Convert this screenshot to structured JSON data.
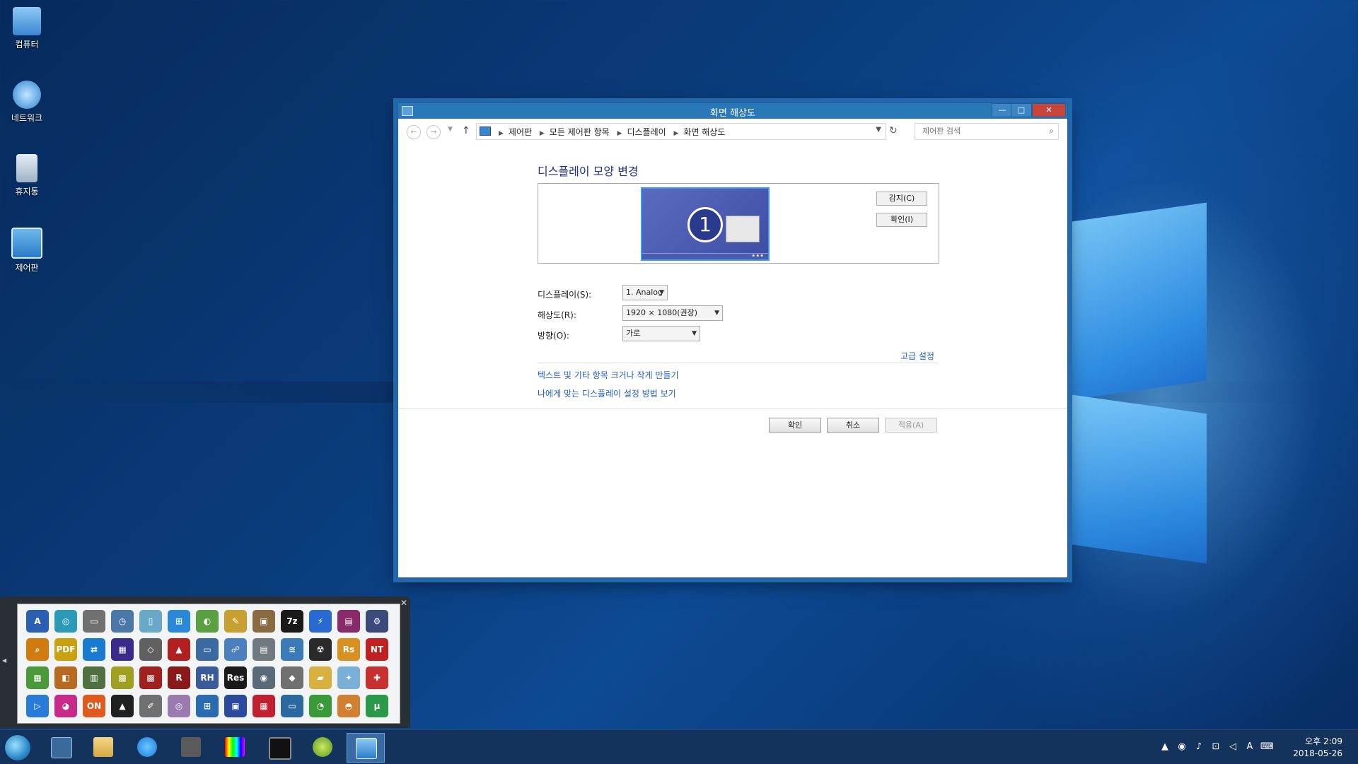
{
  "desktop": {
    "icons": [
      {
        "label": "컴퓨터"
      },
      {
        "label": "네트워크"
      },
      {
        "label": "휴지통"
      },
      {
        "label": "제어판"
      }
    ]
  },
  "window": {
    "title": "화면 해상도",
    "controls": {
      "minimize": "—",
      "maximize": "□",
      "close": "✕"
    },
    "address": {
      "crumbs": [
        "제어판",
        "모든 제어판 항목",
        "디스플레이",
        "화면 해상도"
      ]
    },
    "search": {
      "placeholder": "제어판 검색"
    },
    "heading": "디스플레이 모양 변경",
    "monitor_number": "1",
    "buttons": {
      "detect": "감지(C)",
      "identify": "확인(I)"
    },
    "fields": {
      "display": {
        "label": "디스플레이(S):",
        "value": "1. Analog"
      },
      "resolution": {
        "label": "해상도(R):",
        "value": "1920 × 1080(권장)"
      },
      "orientation": {
        "label": "방향(O):",
        "value": "가로"
      }
    },
    "links": {
      "advanced": "고급 설정",
      "text_size": "텍스트 및 기타 항목 크거나 작게 만들기",
      "which_settings": "나에게 맞는 디스플레이 설정 방법 보기"
    },
    "footer": {
      "ok": "확인",
      "cancel": "취소",
      "apply": "적용(A)"
    }
  },
  "launcher": {
    "close": "✕",
    "icons": [
      {
        "name": "text-editor-icon",
        "glyph": "A",
        "color": "#2b5fb4"
      },
      {
        "name": "sync-icon",
        "glyph": "◎",
        "color": "#2a9ab8"
      },
      {
        "name": "drive-icon",
        "glyph": "▭",
        "color": "#707070"
      },
      {
        "name": "backup-icon",
        "glyph": "◷",
        "color": "#4a78a8"
      },
      {
        "name": "usb-icon",
        "glyph": "▯",
        "color": "#6aa8c8"
      },
      {
        "name": "windows-icon",
        "glyph": "⊞",
        "color": "#2a88d8"
      },
      {
        "name": "paint-icon",
        "glyph": "◐",
        "color": "#5aa040"
      },
      {
        "name": "tools-icon",
        "glyph": "✎",
        "color": "#c8a030"
      },
      {
        "name": "image-icon",
        "glyph": "▣",
        "color": "#8a6a40"
      },
      {
        "name": "7zip-icon",
        "glyph": "7z",
        "color": "#1a1a1a"
      },
      {
        "name": "bolt-icon",
        "glyph": "⚡",
        "color": "#2a6ad0"
      },
      {
        "name": "archive-icon",
        "glyph": "▤",
        "color": "#8a2a6a"
      },
      {
        "name": "settings-icon",
        "glyph": "⚙",
        "color": "#3a4a7a"
      },
      {
        "name": "search-icon",
        "glyph": "⌕",
        "color": "#d07a10"
      },
      {
        "name": "pdf-icon",
        "glyph": "PDF",
        "color": "#c8a010"
      },
      {
        "name": "teamviewer-icon",
        "glyph": "⇄",
        "color": "#1a7ad0"
      },
      {
        "name": "chip-icon",
        "glyph": "▦",
        "color": "#3a2a8a"
      },
      {
        "name": "disk-icon",
        "glyph": "◇",
        "color": "#606060"
      },
      {
        "name": "car-icon",
        "glyph": "▲",
        "color": "#b02020"
      },
      {
        "name": "computer-icon",
        "glyph": "▭",
        "color": "#3a6aa0"
      },
      {
        "name": "network-icon",
        "glyph": "☍",
        "color": "#4a80c0"
      },
      {
        "name": "scanner-icon",
        "glyph": "▤",
        "color": "#707880"
      },
      {
        "name": "fish-icon",
        "glyph": "≋",
        "color": "#3a7ab8"
      },
      {
        "name": "radiation-icon",
        "glyph": "☢",
        "color": "#2a2a2a"
      },
      {
        "name": "rs-icon",
        "glyph": "Rs",
        "color": "#d89020"
      },
      {
        "name": "nt-icon",
        "glyph": "NT",
        "color": "#c02020"
      },
      {
        "name": "cubes-icon",
        "glyph": "▦",
        "color": "#4a9a3a"
      },
      {
        "name": "box-icon",
        "glyph": "◧",
        "color": "#b86a20"
      },
      {
        "name": "memory-icon",
        "glyph": "▥",
        "color": "#507040"
      },
      {
        "name": "puzzle-icon",
        "glyph": "▩",
        "color": "#a0a020"
      },
      {
        "name": "blocks-icon",
        "glyph": "▩",
        "color": "#a02020"
      },
      {
        "name": "r-icon",
        "glyph": "R",
        "color": "#8a1a1a"
      },
      {
        "name": "rh-icon",
        "glyph": "RH",
        "color": "#3a5a9a"
      },
      {
        "name": "res-icon",
        "glyph": "Res",
        "color": "#1a1a1a"
      },
      {
        "name": "hdd-icon",
        "glyph": "◉",
        "color": "#5a6a78"
      },
      {
        "name": "eraser-icon",
        "glyph": "◆",
        "color": "#707070"
      },
      {
        "name": "folder-icon",
        "glyph": "▰",
        "color": "#d8b040"
      },
      {
        "name": "star-icon",
        "glyph": "✦",
        "color": "#7ab0d8"
      },
      {
        "name": "first-aid-icon",
        "glyph": "✚",
        "color": "#c83030"
      },
      {
        "name": "play-icon",
        "glyph": "▷",
        "color": "#2a7ad8"
      },
      {
        "name": "color-wheel-icon",
        "glyph": "◕",
        "color": "#c82a8a"
      },
      {
        "name": "on-icon",
        "glyph": "ON",
        "color": "#e05a20"
      },
      {
        "name": "triangle-icon",
        "glyph": "▲",
        "color": "#202020"
      },
      {
        "name": "pen-icon",
        "glyph": "✐",
        "color": "#707070"
      },
      {
        "name": "cd-icon",
        "glyph": "◎",
        "color": "#9a7ab0"
      },
      {
        "name": "net-share-icon",
        "glyph": "⊞",
        "color": "#2a6ab0"
      },
      {
        "name": "floppy-icon",
        "glyph": "▣",
        "color": "#2a4aa0"
      },
      {
        "name": "cpu-icon",
        "glyph": "▦",
        "color": "#c02030"
      },
      {
        "name": "window-icon",
        "glyph": "▭",
        "color": "#2a6aa0"
      },
      {
        "name": "pie-icon",
        "glyph": "◔",
        "color": "#3a9a3a"
      },
      {
        "name": "cake-icon",
        "glyph": "◓",
        "color": "#d08030"
      },
      {
        "name": "torrent-icon",
        "glyph": "μ",
        "color": "#2a9a4a"
      }
    ]
  },
  "taskbar": {
    "clock": {
      "time": "오후 2:09",
      "date": "2018-05-26"
    },
    "tray": [
      "▲",
      "◉",
      "♪",
      "⊡",
      "◁",
      "A",
      "⌨"
    ]
  }
}
